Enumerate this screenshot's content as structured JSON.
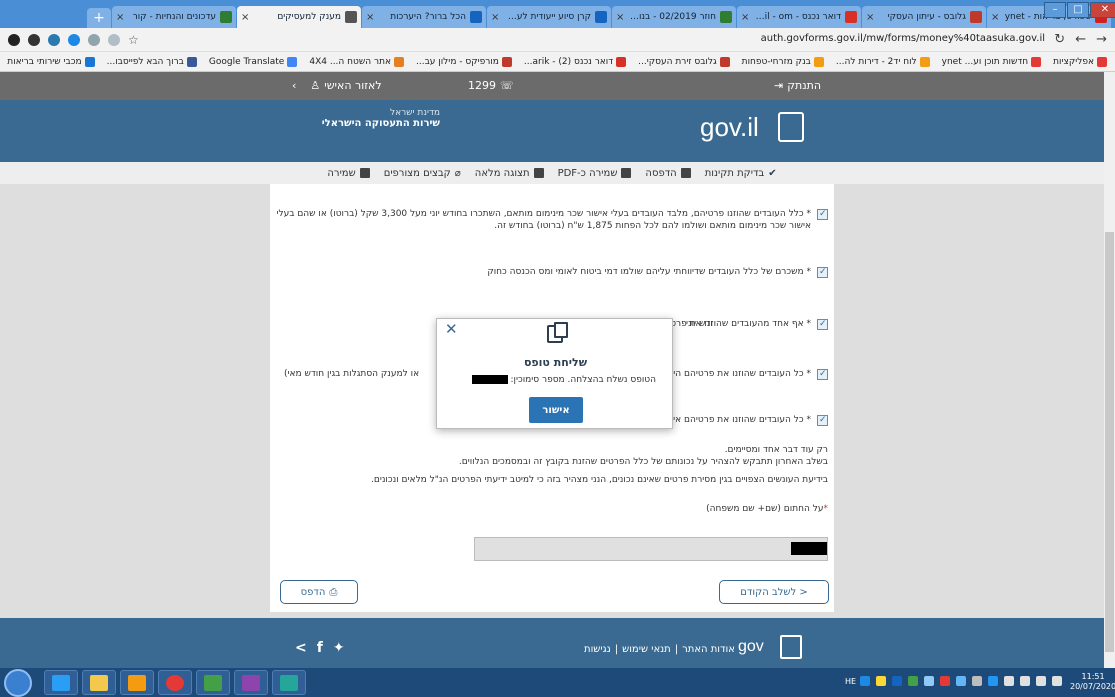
{
  "browser": {
    "tabs": [
      {
        "title": "ספורט, בריאות - ynet",
        "icon_color": "#cc2222"
      },
      {
        "title": "גלובס - עיתון העסקי",
        "icon_color": "#c0392b"
      },
      {
        "title": "דואר נכנס - Gmail - om",
        "icon_color": "#d93025"
      },
      {
        "title": "חוזר 02/2019 - בנושא",
        "icon_color": "#2e7d32"
      },
      {
        "title": "קרן סיוע ייעודית לעסקי",
        "icon_color": "#1565c0"
      },
      {
        "title": "הכל ברור? היערכות",
        "icon_color": "#1565c0"
      },
      {
        "title": "מענק למעסיקים",
        "icon_color": "#555555",
        "active": true
      },
      {
        "title": "עדכונים והנחיות - קור",
        "icon_color": "#2e7d32"
      }
    ],
    "url": "auth.govforms.gov.il/mw/forms/money%40taasuka.gov.il",
    "bookmarks": [
      {
        "label": "אפליקציות",
        "icon_color": "#e53935"
      },
      {
        "label": "חדשות תוכן וע... ynet",
        "icon_color": "#e53935"
      },
      {
        "label": "לוח יד2 - דירות לה...",
        "icon_color": "#f39c12"
      },
      {
        "label": "בנק מזרחי-טפחות",
        "icon_color": "#f39c12"
      },
      {
        "label": "גלובס זירת העסקי...",
        "icon_color": "#c0392b"
      },
      {
        "label": "דואר נכנס (2) - arik...",
        "icon_color": "#d93025"
      },
      {
        "label": "מורפיקס - מילון עב...",
        "icon_color": "#c0392b"
      },
      {
        "label": "אתר השטח ה... 4X4",
        "icon_color": "#e67e22"
      },
      {
        "label": "Google Translate",
        "icon_color": "#4285f4"
      },
      {
        "label": "ברוך הבא לפייסבו...",
        "icon_color": "#3b5998"
      },
      {
        "label": "מכבי שירותי בריאות",
        "icon_color": "#1976d2"
      }
    ]
  },
  "util_bar": {
    "logout": "התנתק",
    "phone": "1299",
    "personal_area": "לאזור האישי"
  },
  "header": {
    "logo_text": "gov.il",
    "agency_line1": "מדינת ישראל",
    "agency_line2": "שירות התעסוקה הישראלי"
  },
  "toolbar": {
    "items": [
      "בדיקת תקינות",
      "הדפסה",
      "שמירה כ-PDF",
      "תצוגה מלאה",
      "קבצים מצורפים",
      "שמירה"
    ]
  },
  "form": {
    "checks": [
      "* כלל העובדים שהוזנו פרטיהם, מלבד העובדים בעלי אישור שכר מינימום מותאם, השתכרו בחודש יוני מעל 3,300 שקל (ברוטו) או שהם בעלי אישור שכר מינימום מותאם ושולמו להם לכל הפחות 1,875 ש\"ח (ברוטו) בחודש זה.",
      "* משכרם של כלל העובדים שדיווחתי עליהם שולמו דמי ביטוח לאומי ומס הכנסה כחוק",
      "* אף אחד מהעובדים שהוזנו את פרטי",
      "* כל העובדים שהוזנו את פרטיהם הינ",
      "* כל העובדים שהוזנו את פרטיהם אינ"
    ],
    "check3_tail": "ודש יוני",
    "check4_tail": "או למענק הסתגלות בגין חודש מאי)",
    "closing_line1": "רק עוד דבר אחד ומסיימים.",
    "closing_line2": "בשלב האחרון תתבקש להצהיר על נכונותם של כלל הפרטים שהזנת בקובץ זה ובמסמכים הנלווים.",
    "declaration": "בידיעת העונשים הצפויים בגין מסירת פרטים שאינם נכונים, הנני מצהיר בזה כי למיטב ידיעתי הפרטים הנ\"ל מלאים ונכונים.",
    "sign_label": "על החתום (שם+ שם משפחה)",
    "sign_required_mark": "*",
    "print_button": "הדפס",
    "prev_button": "< לשלב הקודם"
  },
  "modal": {
    "title": "שליחת טופס",
    "message": "הטופס נשלח בהצלחה. מספר סימוכין:",
    "ok_button": "אישור"
  },
  "footer": {
    "links": [
      "אודות האתר",
      "|",
      "תנאי שימוש",
      "|",
      "נגישות"
    ],
    "gov_text": "gov"
  },
  "taskbar": {
    "lang": "HE",
    "time": "11:51",
    "date": "20/07/2020"
  }
}
